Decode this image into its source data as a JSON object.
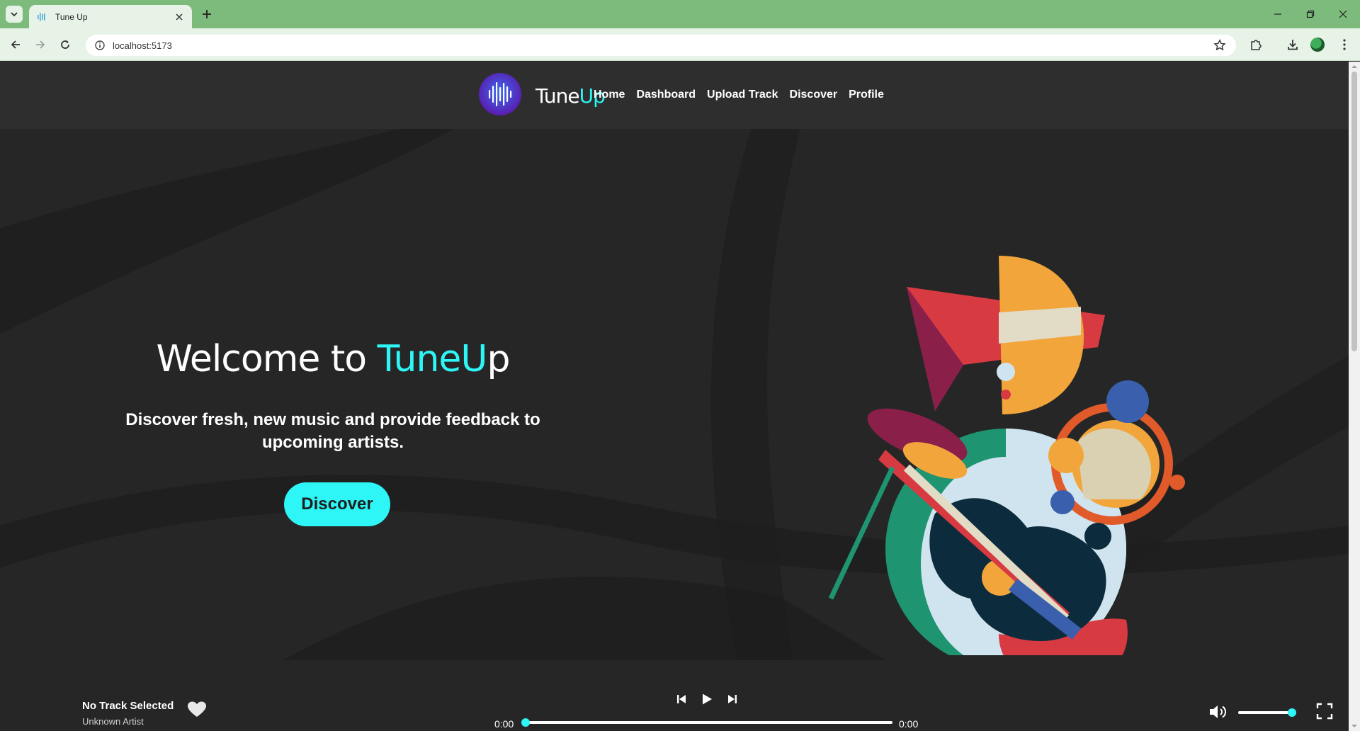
{
  "browser": {
    "tab_title": "Tune Up",
    "url": "localhost:5173"
  },
  "header": {
    "brand_prefix": "Tune",
    "brand_accent": "Up",
    "nav": [
      "Home",
      "Dashboard",
      "Upload Track",
      "Discover",
      "Profile"
    ]
  },
  "hero": {
    "welcome_prefix": "Welcome to ",
    "welcome_brand_1": "Tune",
    "welcome_brand_2": "U",
    "welcome_brand_3": "p",
    "subtitle": "Discover fresh, new music and provide feedback to upcoming artists.",
    "cta_label": "Discover"
  },
  "player": {
    "track_title": "No Track Selected",
    "track_artist": "Unknown Artist",
    "current_time": "0:00",
    "duration": "0:00",
    "progress": 0,
    "volume": 1
  },
  "icons": {
    "tab_list": "chevron-down-icon",
    "favicon": "tuneup-favicon-icon",
    "tab_close": "close-icon",
    "new_tab": "plus-icon",
    "back": "arrow-left-icon",
    "forward": "arrow-right-icon",
    "reload": "reload-icon",
    "site_info": "site-info-icon",
    "bookmark": "star-icon",
    "extensions": "puzzle-icon",
    "downloads": "download-icon",
    "menu": "kebab-menu-icon",
    "like": "heart-icon",
    "previous": "skip-previous-icon",
    "play": "play-icon",
    "next": "skip-next-icon",
    "volume": "volume-icon",
    "fullscreen": "fullscreen-icon"
  },
  "colors": {
    "accent": "#2ef6f6",
    "page_bg": "#262626",
    "header_bg": "#2e2e2e",
    "chrome_tabbar": "#7dbb7d",
    "chrome_toolbar": "#e8f3e8"
  }
}
